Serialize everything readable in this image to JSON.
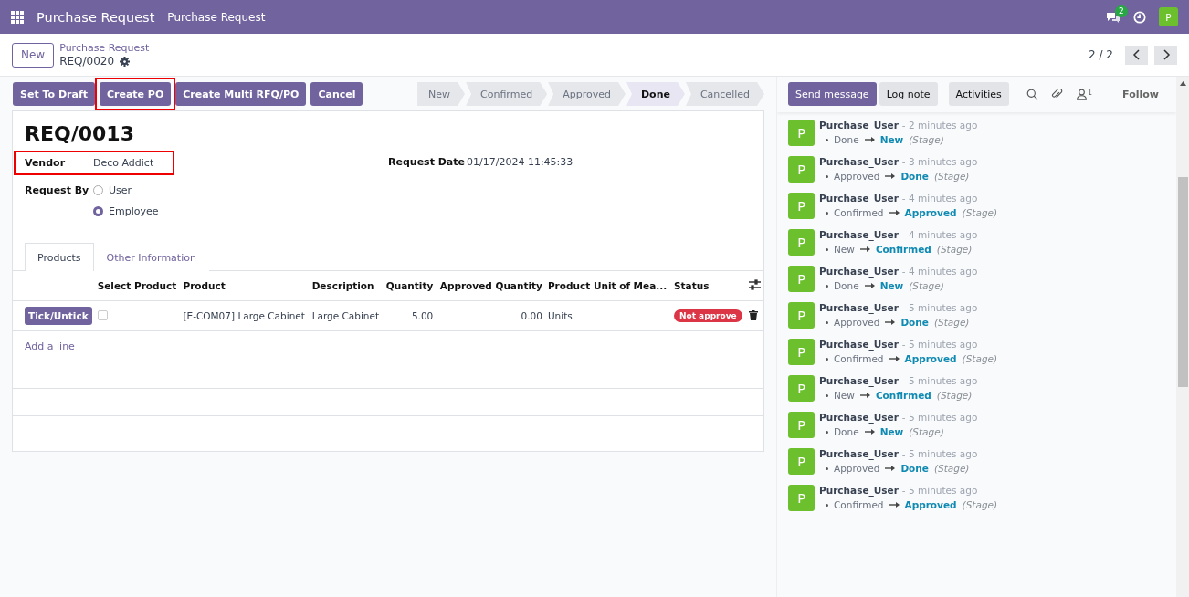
{
  "navbar": {
    "app": "Purchase Request",
    "menu": [
      "Purchase Request"
    ],
    "message_count": "2",
    "avatar": "P"
  },
  "control_panel": {
    "new_button": "New",
    "breadcrumb": "Purchase Request",
    "record": "REQ/0020",
    "pager": "2 / 2"
  },
  "actions": [
    {
      "label": "Set To Draft",
      "highlighted": false
    },
    {
      "label": "Create PO",
      "highlighted": true
    },
    {
      "label": "Create Multi RFQ/PO",
      "highlighted": false
    },
    {
      "label": "Cancel",
      "highlighted": false
    }
  ],
  "stages": [
    {
      "label": "New",
      "selected": false
    },
    {
      "label": "Confirmed",
      "selected": false
    },
    {
      "label": "Approved",
      "selected": false
    },
    {
      "label": "Done",
      "selected": true
    },
    {
      "label": "Cancelled",
      "selected": false
    }
  ],
  "form": {
    "title": "REQ/0013",
    "vendor": {
      "label": "Vendor",
      "value": "Deco Addict",
      "highlighted": true
    },
    "request_date": {
      "label": "Request Date",
      "value": "01/17/2024 11:45:33"
    },
    "request_by": {
      "label": "Request By",
      "options": [
        {
          "label": "User",
          "selected": false
        },
        {
          "label": "Employee",
          "selected": true
        }
      ]
    },
    "tabs": [
      {
        "label": "Products",
        "selected": true
      },
      {
        "label": "Other Information",
        "selected": false
      }
    ],
    "table": {
      "columns": [
        "Select Product",
        "Product",
        "Description",
        "Quantity",
        "Approved Quantity",
        "Product Unit of Mea...",
        "Status"
      ],
      "rows": [
        {
          "button": "Tick/Untick",
          "checked": false,
          "product": "[E-COM07] Large Cabinet",
          "description": "Large Cabinet",
          "quantity": "5.00",
          "approved_quantity": "0.00",
          "uom": "Units",
          "status": "Not approve"
        }
      ],
      "add_line": "Add a line"
    }
  },
  "chatter": {
    "buttons": [
      "Send message",
      "Log note",
      "Activities"
    ],
    "followers": "1",
    "follow": "Follow",
    "messages": [
      {
        "avatar": "P",
        "author": "Purchase_User",
        "time": "- 2 minutes ago",
        "from": "Done",
        "to": "New",
        "field": "(Stage)"
      },
      {
        "avatar": "P",
        "author": "Purchase_User",
        "time": "- 3 minutes ago",
        "from": "Approved",
        "to": "Done",
        "field": "(Stage)"
      },
      {
        "avatar": "P",
        "author": "Purchase_User",
        "time": "- 4 minutes ago",
        "from": "Confirmed",
        "to": "Approved",
        "field": "(Stage)"
      },
      {
        "avatar": "P",
        "author": "Purchase_User",
        "time": "- 4 minutes ago",
        "from": "New",
        "to": "Confirmed",
        "field": "(Stage)"
      },
      {
        "avatar": "P",
        "author": "Purchase_User",
        "time": "- 4 minutes ago",
        "from": "Done",
        "to": "New",
        "field": "(Stage)"
      },
      {
        "avatar": "P",
        "author": "Purchase_User",
        "time": "- 5 minutes ago",
        "from": "Approved",
        "to": "Done",
        "field": "(Stage)"
      },
      {
        "avatar": "P",
        "author": "Purchase_User",
        "time": "- 5 minutes ago",
        "from": "Confirmed",
        "to": "Approved",
        "field": "(Stage)"
      },
      {
        "avatar": "P",
        "author": "Purchase_User",
        "time": "- 5 minutes ago",
        "from": "New",
        "to": "Confirmed",
        "field": "(Stage)"
      },
      {
        "avatar": "P",
        "author": "Purchase_User",
        "time": "- 5 minutes ago",
        "from": "Done",
        "to": "New",
        "field": "(Stage)"
      },
      {
        "avatar": "P",
        "author": "Purchase_User",
        "time": "- 5 minutes ago",
        "from": "Approved",
        "to": "Done",
        "field": "(Stage)"
      },
      {
        "avatar": "P",
        "author": "Purchase_User",
        "time": "- 5 minutes ago",
        "from": "Confirmed",
        "to": "Approved",
        "field": "(Stage)"
      }
    ]
  }
}
